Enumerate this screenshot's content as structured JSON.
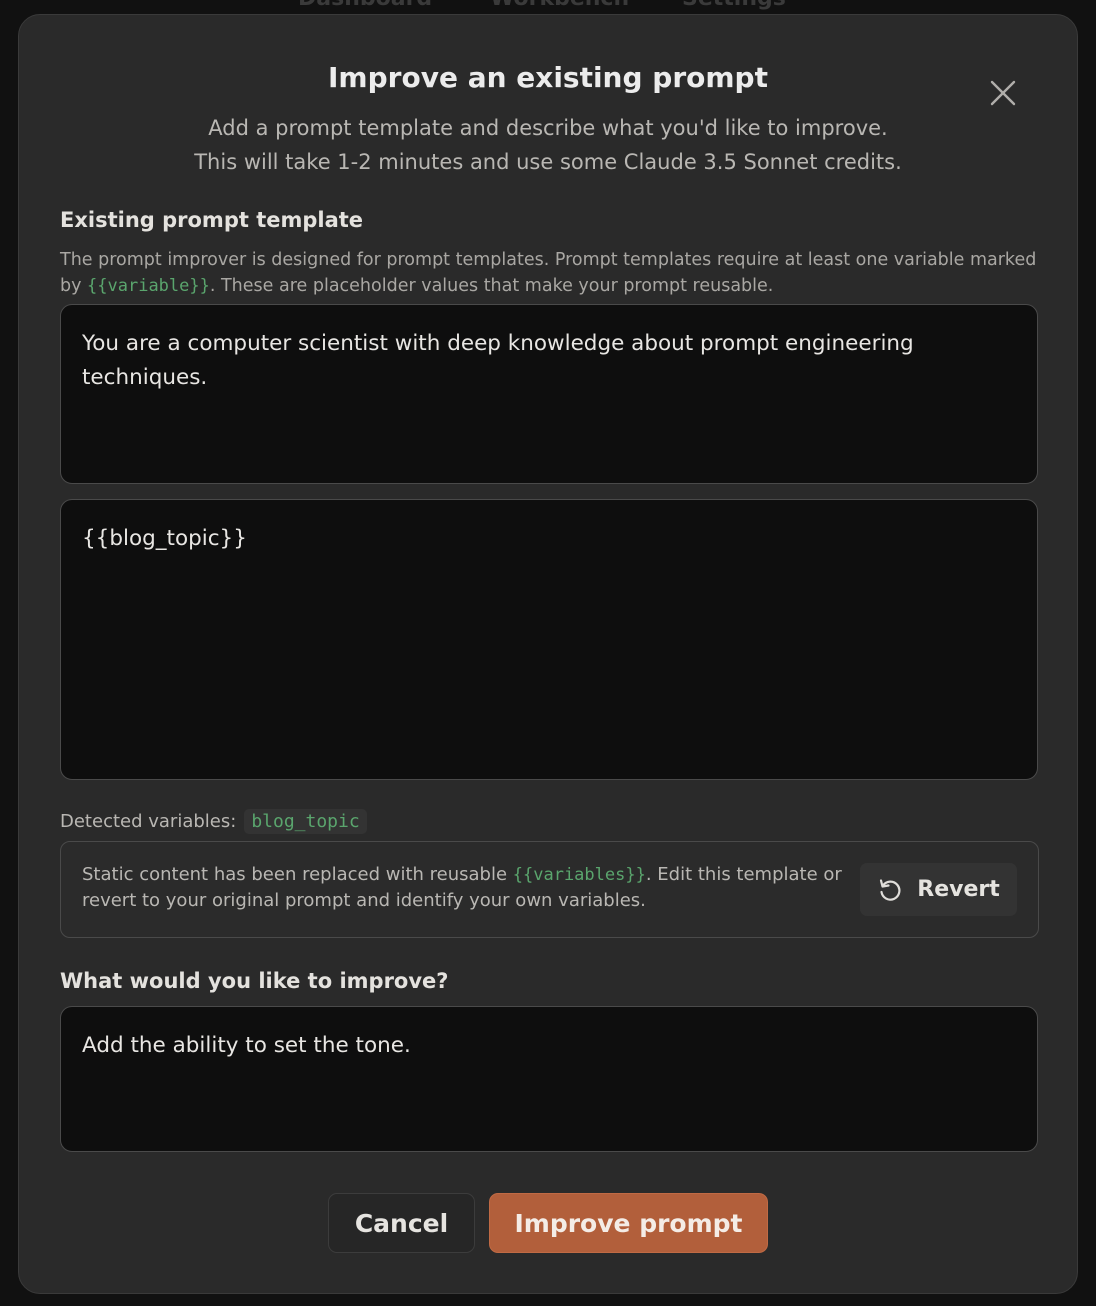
{
  "backdrop": {
    "nav": [
      "Dashboard",
      "Workbench",
      "Settings"
    ]
  },
  "modal": {
    "title": "Improve an existing prompt",
    "subtitle_line1": "Add a prompt template and describe what you'd like to improve.",
    "subtitle_line2": "This will take 1-2 minutes and use some Claude 3.5 Sonnet credits.",
    "close_icon": "close-icon"
  },
  "template_section": {
    "label": "Existing prompt template",
    "help_part1": "The prompt improver is designed for prompt templates. Prompt templates require at least one variable marked by ",
    "help_code": "{{variable}}",
    "help_part2": ". These are placeholder values that make your prompt reusable.",
    "system_prompt_value": "You are a computer scientist with deep knowledge about prompt engineering techniques.",
    "user_prompt_value": "{{blog_topic}}"
  },
  "detected": {
    "label": "Detected variables:",
    "variables": [
      "blog_topic"
    ]
  },
  "notice": {
    "text_part1": "Static content has been replaced with reusable ",
    "text_code": "{{variables}}",
    "text_part2": ". Edit this template or revert to your original prompt and identify your own variables.",
    "revert_label": "Revert",
    "revert_icon": "undo-icon"
  },
  "improve_section": {
    "label": "What would you like to improve?",
    "value": "Add the ability to set the tone."
  },
  "footer": {
    "cancel_label": "Cancel",
    "improve_label": "Improve prompt"
  },
  "colors": {
    "accent": "#b25f3b",
    "variable": "#5aa56d",
    "modal_bg": "#2a2a2a",
    "input_bg": "#0e0e0e"
  }
}
